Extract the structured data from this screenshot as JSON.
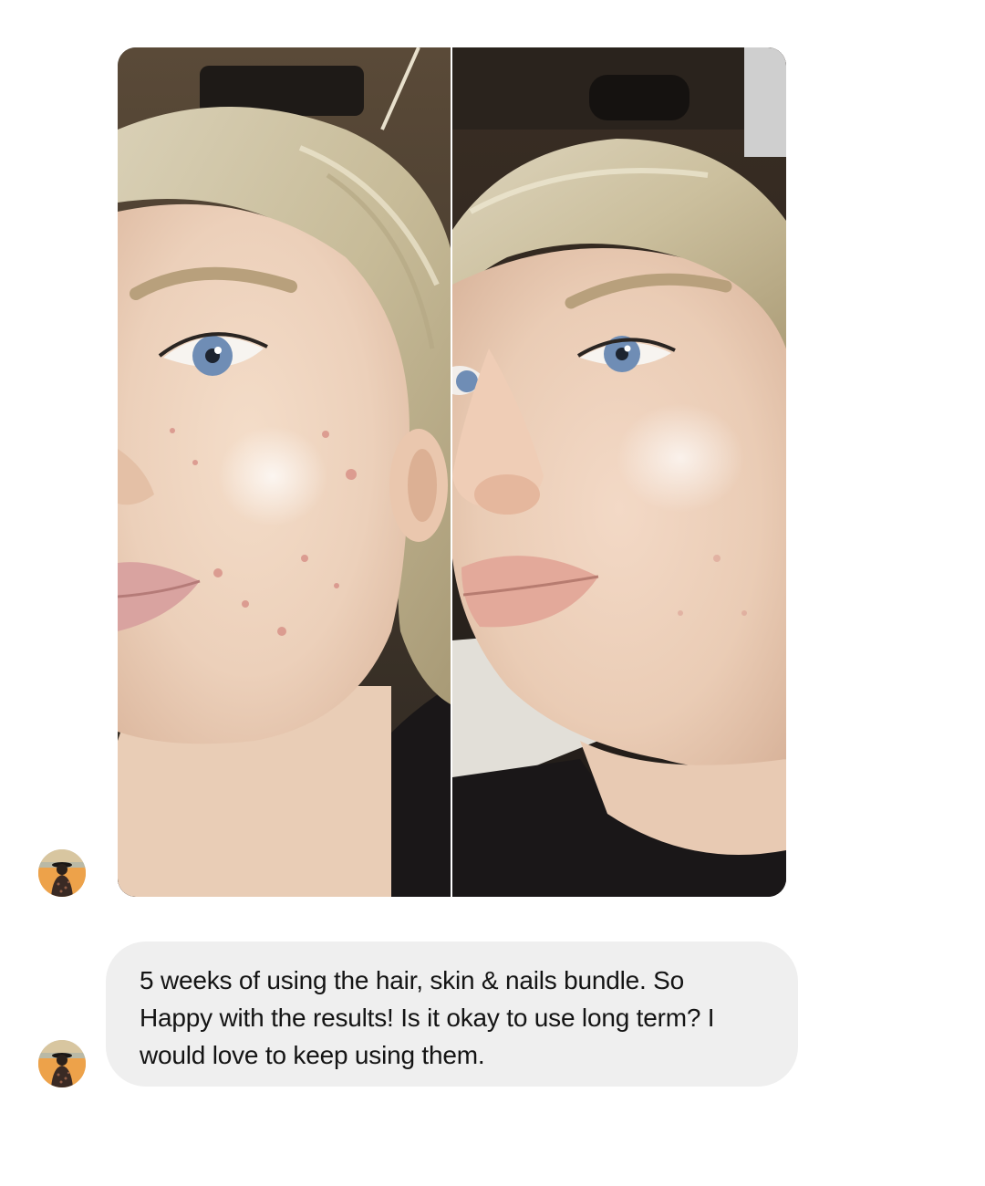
{
  "conversation": {
    "photo_message": {
      "panels": [
        {
          "id": "before"
        },
        {
          "id": "after"
        }
      ]
    },
    "text_message": {
      "text": "5 weeks of using the hair, skin & nails bundle. So Happy with the results! Is it okay to use long term? I would love to keep using them."
    },
    "avatar_icon": "user-avatar-photo"
  },
  "colors": {
    "page_background": "#ffffff",
    "bubble_background": "#efefef",
    "text": "#141414"
  }
}
